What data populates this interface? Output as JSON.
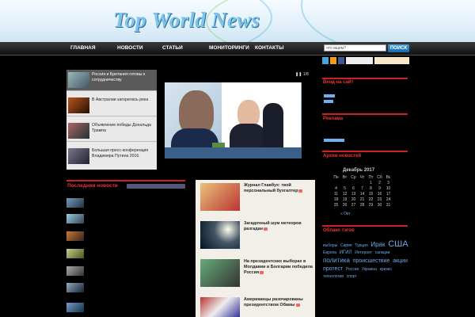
{
  "site": {
    "title": "Top World News"
  },
  "nav": {
    "items": [
      {
        "label": "ГЛАВНАЯ"
      },
      {
        "label": "НОВОСТИ"
      },
      {
        "label": "СТАТЬИ"
      },
      {
        "label": "МОНИТОРИНГИ"
      },
      {
        "label": "КОНТАКТЫ"
      }
    ]
  },
  "search": {
    "placeholder": "что ищем?",
    "button": "ПОИСК"
  },
  "slider": {
    "counter": "1/8",
    "items": [
      {
        "caption": "Россия и Британия готовы к сотрудничеству"
      },
      {
        "caption": "В Австралии загорелась река"
      },
      {
        "caption": "Объявление победы Дональда Трампа"
      },
      {
        "caption": "Большая пресс-конференция Владимира Путина 2016."
      }
    ]
  },
  "latest": {
    "heading": "Последняя новости"
  },
  "center_news": [
    {
      "title": "Журнал Главбух: твой персональный бухгалтер"
    },
    {
      "title": "Загадочный шум метеоров разгадан"
    },
    {
      "title": "На президентских выборах в Молдавии и Болгарии победила Россия"
    },
    {
      "title": "Американцы разочарованы президентством Обамы"
    }
  ],
  "sidebar": {
    "login_heading": "Вход на сайт",
    "ads_heading": "Реклама",
    "archive_heading": "Архив новостей",
    "calendar": {
      "title": "Декабрь 2017",
      "weekdays": [
        "Пн",
        "Вт",
        "Ср",
        "Чт",
        "Пт",
        "Сб",
        "Вс"
      ],
      "weeks": [
        [
          "",
          "",
          "",
          "",
          "1",
          "2",
          "3"
        ],
        [
          "4",
          "5",
          "6",
          "7",
          "8",
          "9",
          "10"
        ],
        [
          "11",
          "12",
          "13",
          "14",
          "15",
          "16",
          "17"
        ],
        [
          "18",
          "19",
          "20",
          "21",
          "22",
          "23",
          "24"
        ],
        [
          "25",
          "26",
          "27",
          "28",
          "29",
          "30",
          "31"
        ]
      ],
      "prev": "« Окт"
    },
    "tags_heading": "Облако тэгов",
    "tags": [
      "США",
      "ИГИЛ",
      "Ирак",
      "Россия",
      "политика",
      "происшествие",
      "акции",
      "протест",
      "Украина",
      "Европа",
      "Интернет",
      "выборы",
      "кризис",
      "Сирия",
      "Турция",
      "санкции",
      "технологии",
      "спорт"
    ]
  },
  "colors": {
    "accent_red": "#c82222",
    "link_blue": "#6bb0f0",
    "banner_blue": "#7fc4ea"
  }
}
